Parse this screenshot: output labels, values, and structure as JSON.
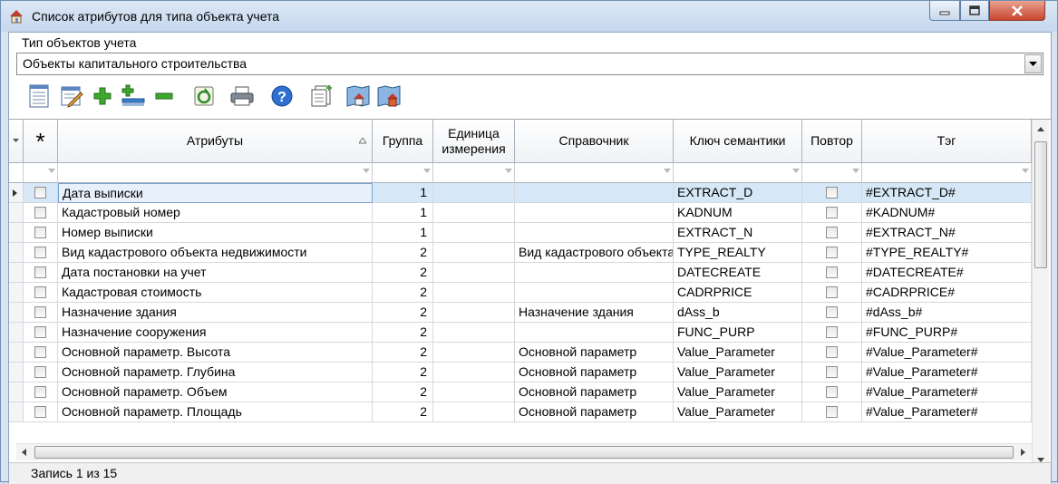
{
  "window": {
    "title": "Список атрибутов для типа объекта учета"
  },
  "object_type": {
    "label": "Тип объектов учета",
    "value": "Объекты капитального строительства"
  },
  "toolbar": {
    "buttons": [
      "list-icon",
      "edit-icon",
      "add-icon",
      "add-group-icon",
      "remove-icon",
      "refresh-icon",
      "print-icon",
      "help-icon",
      "copy-icon",
      "map-open-icon",
      "map-save-icon"
    ]
  },
  "table": {
    "row_header_symbol": "*",
    "columns": [
      "Атрибуты",
      "Группа",
      "Единица измерения",
      "Справочник",
      "Ключ семантики",
      "Повтор",
      "Тэг"
    ],
    "rows": [
      {
        "name": "Дата выписки",
        "group": "1",
        "unit": "",
        "ref": "",
        "key": "EXTRACT_D",
        "tag": "#EXTRACT_D#"
      },
      {
        "name": "Кадастровый номер",
        "group": "1",
        "unit": "",
        "ref": "",
        "key": "KADNUM",
        "tag": "#KADNUM#"
      },
      {
        "name": "Номер выписки",
        "group": "1",
        "unit": "",
        "ref": "",
        "key": "EXTRACT_N",
        "tag": "#EXTRACT_N#"
      },
      {
        "name": "Вид кадастрового объекта недвижимости",
        "group": "2",
        "unit": "",
        "ref": "Вид кадастрового объекта",
        "key": "TYPE_REALTY",
        "tag": "#TYPE_REALTY#"
      },
      {
        "name": "Дата постановки на учет",
        "group": "2",
        "unit": "",
        "ref": "",
        "key": "DATECREATE",
        "tag": "#DATECREATE#"
      },
      {
        "name": "Кадастровая стоимость",
        "group": "2",
        "unit": "",
        "ref": "",
        "key": "CADRPRICE",
        "tag": "#CADRPRICE#"
      },
      {
        "name": "Назначение здания",
        "group": "2",
        "unit": "",
        "ref": "Назначение здания",
        "key": "dAss_b",
        "tag": "#dAss_b#"
      },
      {
        "name": "Назначение сооружения",
        "group": "2",
        "unit": "",
        "ref": "",
        "key": "FUNC_PURP",
        "tag": "#FUNC_PURP#"
      },
      {
        "name": "Основной параметр. Высота",
        "group": "2",
        "unit": "",
        "ref": "Основной параметр",
        "key": "Value_Parameter",
        "tag": "#Value_Parameter#"
      },
      {
        "name": "Основной параметр. Глубина",
        "group": "2",
        "unit": "",
        "ref": "Основной параметр",
        "key": "Value_Parameter",
        "tag": "#Value_Parameter#"
      },
      {
        "name": "Основной параметр. Объем",
        "group": "2",
        "unit": "",
        "ref": "Основной параметр",
        "key": "Value_Parameter",
        "tag": "#Value_Parameter#"
      },
      {
        "name": "Основной параметр. Площадь",
        "group": "2",
        "unit": "",
        "ref": "Основной параметр",
        "key": "Value_Parameter",
        "tag": "#Value_Parameter#"
      }
    ]
  },
  "status": {
    "text": "Запись 1 из 15"
  },
  "colors": {
    "selected_row": "#d6e8f7",
    "titlebar": "#c6d8ee"
  }
}
